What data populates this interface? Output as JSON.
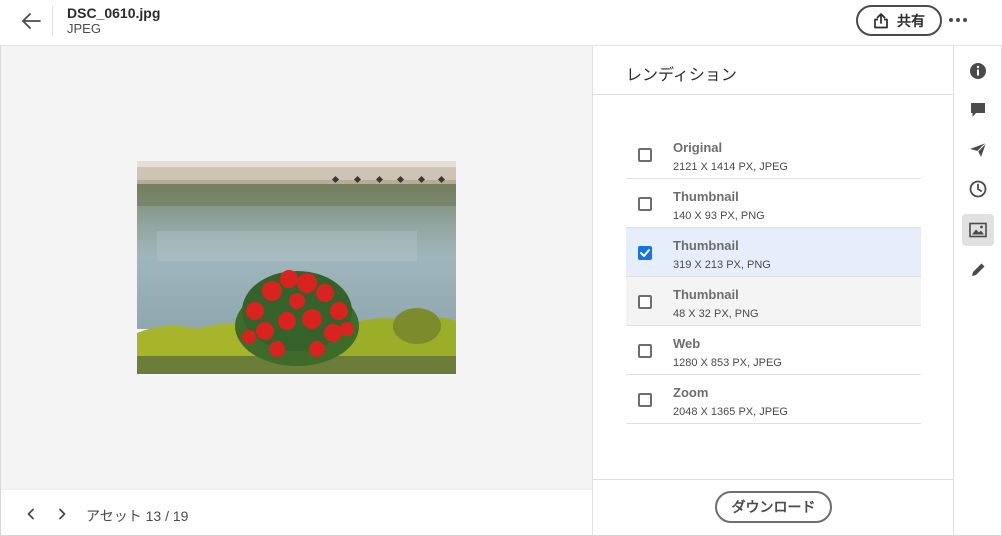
{
  "header": {
    "file_name": "DSC_0610.jpg",
    "file_type": "JPEG",
    "share_label": "共有",
    "back_icon": "arrow-left-icon",
    "more_icon": "more-icon"
  },
  "bottom": {
    "asset_counter": "アセット 13 / 19"
  },
  "panel": {
    "title": "レンディション",
    "renditions": [
      {
        "name": "Original",
        "meta": "2121 X 1414 PX, JPEG",
        "checked": false
      },
      {
        "name": "Thumbnail",
        "meta": "140 X 93 PX, PNG",
        "checked": false
      },
      {
        "name": "Thumbnail",
        "meta": "319 X 213 PX, PNG",
        "checked": true
      },
      {
        "name": "Thumbnail",
        "meta": "48 X 32 PX, PNG",
        "checked": false
      },
      {
        "name": "Web",
        "meta": "1280 X 853 PX, JPEG",
        "checked": false
      },
      {
        "name": "Zoom",
        "meta": "2048 X 1365 PX, JPEG",
        "checked": false
      }
    ],
    "download_label": "ダウンロード"
  },
  "rail": {
    "icons": [
      "info-icon",
      "comment-icon",
      "send-icon",
      "history-icon",
      "image-icon",
      "edit-icon"
    ],
    "active": "image-icon"
  },
  "colors": {
    "accent": "#1473e6",
    "selected_row": "#e5eefa",
    "preview_bg": "#f4f4f4"
  }
}
